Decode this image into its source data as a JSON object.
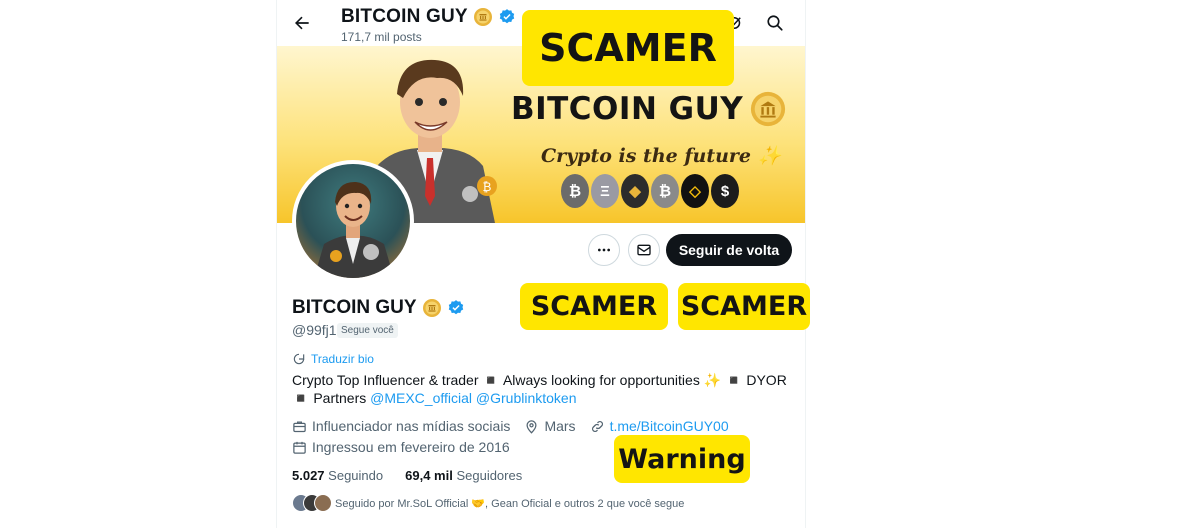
{
  "header": {
    "title": "BITCOIN GUY",
    "post_count": "171,7 mil posts"
  },
  "banner": {
    "brand": "BITCOIN GUY",
    "tagline": "Crypto is the future ✨",
    "coins": [
      "₿",
      "Ξ",
      "◆",
      "₿",
      "◇",
      "$"
    ]
  },
  "actions": {
    "follow_back_label": "Seguir de volta"
  },
  "profile": {
    "name": "BITCOIN GUY",
    "handle": "@99fj1",
    "follows_you": "Segue você",
    "translate_bio": "Traduzir bio",
    "bio_text": "Crypto Top Influencer & trader ◾ Always looking for opportunities ✨ ◾ DYOR ◾ Partners",
    "bio_mention_1": "@MEXC_official",
    "bio_mention_2": "@Grublinktoken",
    "category": "Influenciador nas mídias sociais",
    "location": "Mars",
    "link": "t.me/BitcoinGUY00",
    "joined": "Ingressou em fevereiro de 2016"
  },
  "stats": {
    "following_count": "5.027",
    "following_label": "Seguindo",
    "followers_count": "69,4 mil",
    "followers_label": "Seguidores"
  },
  "followed_by": {
    "text": "Seguido por Mr.SoL Official 🤝, Gean Oficial e outros 2 que você segue"
  },
  "overlays": {
    "top": "SCAMER",
    "mid_left": "SCAMER",
    "mid_right": "SCAMER",
    "warning": "Warning"
  },
  "colors": {
    "accent": "#1d9bf0",
    "overlay": "#ffe600",
    "follow_button": "#0f1419",
    "banner": "#fde27a"
  }
}
